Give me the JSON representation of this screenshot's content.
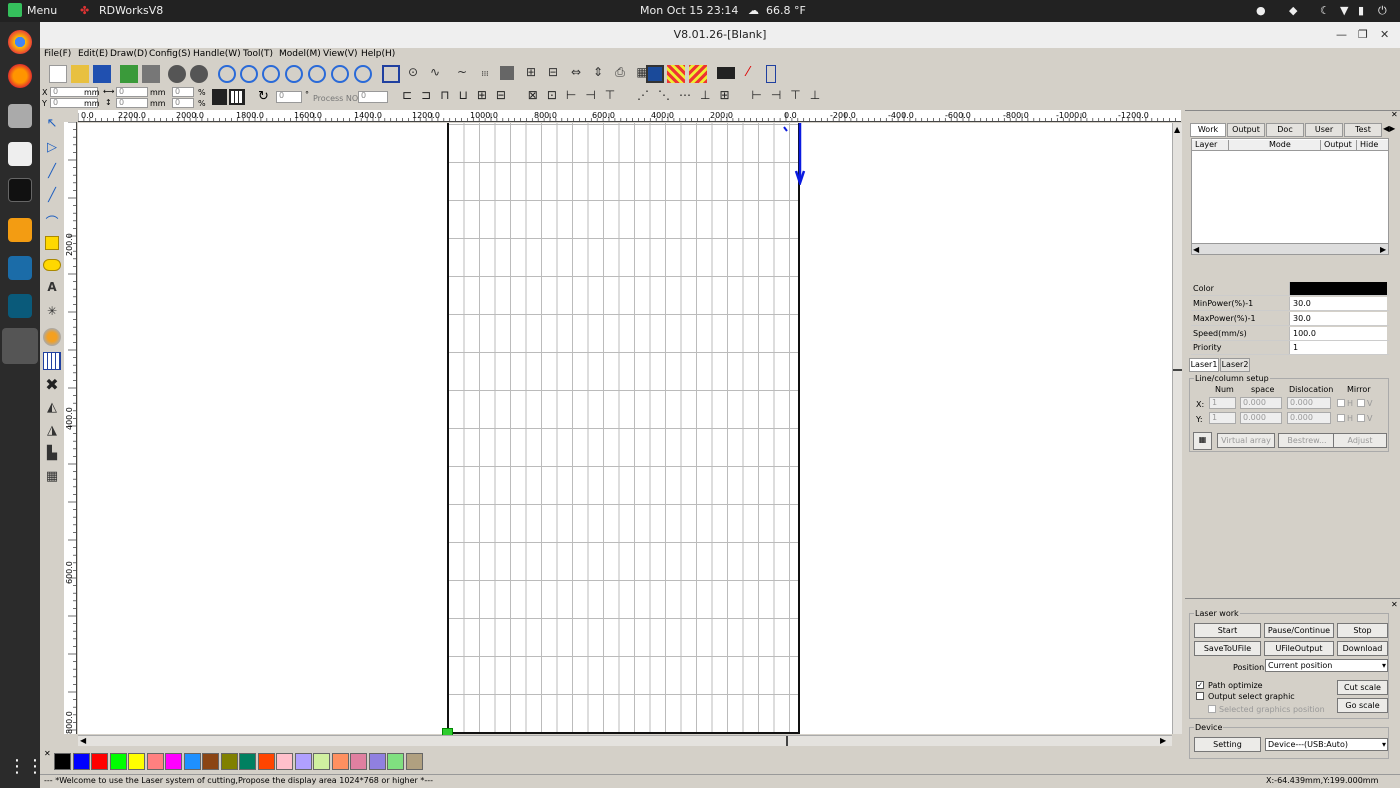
{
  "topbar": {
    "menu": "Menu",
    "app": "RDWorksV8",
    "datetime": "Mon Oct 15  23:14",
    "weather": "66.8 °F"
  },
  "window": {
    "title": "V8.01.26-[Blank]"
  },
  "menu": [
    "File(F)",
    "Edit(E)",
    "Draw(D)",
    "Config(S)",
    "Handle(W)",
    "Tool(T)",
    "Model(M)",
    "View(V)",
    "Help(H)"
  ],
  "props": {
    "x_label": "X",
    "y_label": "Y",
    "x_val": "0",
    "y_val": "0",
    "w_val": "0",
    "h_val": "0",
    "unit": "mm",
    "pct": "%",
    "sx": "0",
    "sy": "0",
    "rot": "0",
    "deg": "°",
    "process_label": "Process NO",
    "process_val": "0"
  },
  "ruler_h": [
    "0.0",
    "2200.0",
    "2000.0",
    "1800.0",
    "1600.0",
    "1400.0",
    "1200.0",
    "1000.0",
    "800.0",
    "600.0",
    "400.0",
    "200.0",
    "0.0",
    "-200.0",
    "-400.0",
    "-600.0",
    "-800.0",
    "-1000.0",
    "-1200.0"
  ],
  "ruler_v": [
    "200.0",
    "400.0",
    "600.0",
    "800.0"
  ],
  "tabs": [
    "Work",
    "Output",
    "Doc",
    "User",
    "Test"
  ],
  "layer_headers": [
    "Layer",
    "Mode",
    "Output",
    "Hide"
  ],
  "layer_props": [
    {
      "k": "Color",
      "v": ""
    },
    {
      "k": "MinPower(%)-1",
      "v": "30.0"
    },
    {
      "k": "MaxPower(%)-1",
      "v": "30.0"
    },
    {
      "k": "Speed(mm/s)",
      "v": "100.0"
    },
    {
      "k": "Priority",
      "v": "1"
    }
  ],
  "laser_tabs": [
    "Laser1",
    "Laser2"
  ],
  "array": {
    "title": "Line/column setup",
    "num": "Num",
    "space": "space",
    "dislocation": "Dislocation",
    "mirror": "Mirror",
    "x": "X:",
    "y": "Y:",
    "x_num": "1",
    "x_space": "0.000",
    "x_disl": "0.000",
    "y_num": "1",
    "y_space": "0.000",
    "y_disl": "0.000",
    "h": "H",
    "v": "V",
    "virtual": "Virtual array",
    "bestrew": "Bestrew...",
    "adjust": "Adjust"
  },
  "laserwork": {
    "title": "Laser work",
    "start": "Start",
    "pause": "Pause/Continue",
    "stop": "Stop",
    "save": "SaveToUFile",
    "ufile": "UFileOutput",
    "download": "Download",
    "position_label": "Position",
    "position_val": "Current position",
    "path_opt": "Path optimize",
    "output_sel": "Output select graphic",
    "sel_pos": "Selected graphics position",
    "cut_scale": "Cut scale",
    "go_scale": "Go scale"
  },
  "device": {
    "title": "Device",
    "setting": "Setting",
    "device_val": "Device---(USB:Auto)"
  },
  "palette": [
    "#000000",
    "#0000ff",
    "#ff0000",
    "#00ff00",
    "#ffff00",
    "#ff8080",
    "#ff00ff",
    "#1e90ff",
    "#8b4513",
    "#808000",
    "#008060",
    "#ff4500",
    "#ffc0cb",
    "#b0a0ff",
    "#d0f0a0",
    "#ff9060",
    "#e080a0",
    "#9080e0",
    "#80e080",
    "#b0a080"
  ],
  "status": {
    "msg": "--- *Welcome to use the Laser system of cutting,Propose the display area 1024*768 or higher *---",
    "coords": "X:-64.439mm,Y:199.000mm"
  }
}
